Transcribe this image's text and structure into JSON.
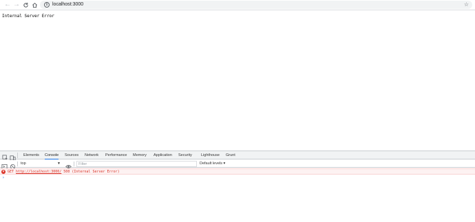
{
  "browser": {
    "url": "localhost:3000",
    "icons": {
      "back": "back-arrow-icon",
      "forward": "forward-arrow-icon",
      "reload": "reload-icon",
      "home": "home-icon",
      "info": "info-icon",
      "bookmark": "star-icon"
    }
  },
  "page": {
    "body_text": "Internal Server Error"
  },
  "devtools": {
    "tabs": [
      {
        "label": "Elements"
      },
      {
        "label": "Console",
        "active": true
      },
      {
        "label": "Sources"
      },
      {
        "label": "Network"
      },
      {
        "label": "Performance"
      },
      {
        "label": "Memory"
      },
      {
        "label": "Application"
      },
      {
        "label": "Security"
      },
      {
        "label": "Lighthouse"
      },
      {
        "label": "Grunt"
      }
    ],
    "console": {
      "context": "top",
      "filter_placeholder": "Filter",
      "levels": "Default levels ▾",
      "messages": [
        {
          "level": "error",
          "method": "GET",
          "url": "http://localhost:3000/",
          "status": "500 (Internal Server Error)"
        }
      ],
      "prompt": "›"
    },
    "colors": {
      "accent": "#1a73e8",
      "error": "#d93025",
      "error_bg": "#fdf2f2"
    }
  }
}
